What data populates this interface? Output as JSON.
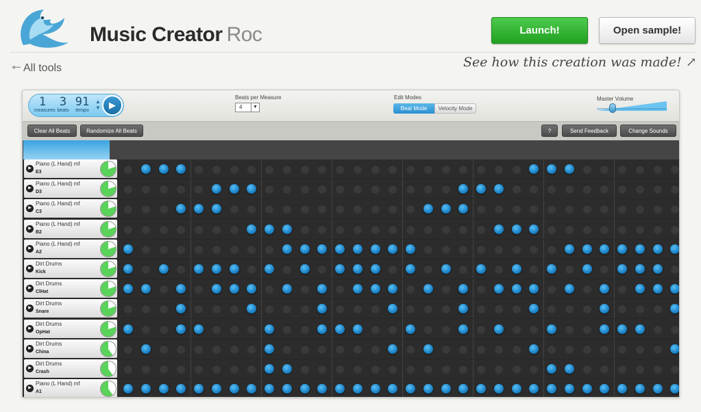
{
  "header": {
    "title": "Music Creator",
    "title_sub": "Roc",
    "launch_label": "Launch!",
    "sample_label": "Open sample!",
    "all_tools_label": "All tools",
    "see_how_label": "See how this creation was made!"
  },
  "counter": {
    "measures": "1",
    "measures_label": "measures",
    "beats": "3",
    "beats_label": "beats",
    "tempo": "91",
    "tempo_label": "tempo"
  },
  "controls": {
    "bpm_label": "Beats per Measure",
    "bpm_value": "4",
    "modes_label": "Edit Modes",
    "beat_mode": "Beat Mode",
    "velocity_mode": "Velocity Mode",
    "volume_label": "Master Volume",
    "volume_level": 0.2
  },
  "toolbar": {
    "clear_all": "Clear All Beats",
    "randomize_all": "Randomize All Beats",
    "help": "?",
    "send_feedback": "Send Feedback",
    "change_sounds": "Change Sounds"
  },
  "colors": {
    "beat_on": "#1b82c7",
    "launch": "#22a022",
    "playhead": "#3aa3e0"
  },
  "rows": [
    {
      "instrument": "Piano (L Hand) mf",
      "note": "E3",
      "beats": [
        1,
        2,
        3,
        23,
        24,
        25
      ]
    },
    {
      "instrument": "Piano (L Hand) mf",
      "note": "D3",
      "beats": [
        5,
        6,
        7,
        19,
        20,
        21
      ]
    },
    {
      "instrument": "Piano (L Hand) mf",
      "note": "C3",
      "beats": [
        3,
        4,
        5,
        17,
        18,
        19
      ]
    },
    {
      "instrument": "Piano (L Hand) mf",
      "note": "B2",
      "beats": [
        7,
        8,
        9,
        21,
        22,
        23
      ]
    },
    {
      "instrument": "Piano (L Hand) mf",
      "note": "A2",
      "beats": [
        0,
        9,
        10,
        11,
        12,
        13,
        14,
        15,
        16,
        25,
        26,
        27,
        28,
        29,
        30,
        31
      ]
    },
    {
      "instrument": "Dirt Drums",
      "note": "Kick",
      "beats": [
        0,
        2,
        4,
        5,
        6,
        8,
        10,
        12,
        13,
        14,
        16,
        18,
        20,
        22,
        24,
        26,
        28,
        29,
        30
      ]
    },
    {
      "instrument": "Dirt Drums",
      "note": "ClHat",
      "beats": [
        0,
        1,
        3,
        5,
        6,
        7,
        9,
        11,
        13,
        14,
        15,
        17,
        19,
        21,
        22,
        23,
        25,
        27,
        29,
        30,
        31
      ]
    },
    {
      "instrument": "Dirt Drums",
      "note": "Snare",
      "beats": [
        3,
        7,
        11,
        15,
        19,
        23,
        27,
        31
      ]
    },
    {
      "instrument": "Dirt Drums",
      "note": "OpHat",
      "beats": [
        0,
        3,
        4,
        8,
        11,
        12,
        13,
        16,
        19,
        21,
        24,
        27,
        28,
        29
      ]
    },
    {
      "instrument": "Dirt Drums",
      "note": "China",
      "beats": [
        1,
        8,
        15,
        17,
        23,
        31
      ]
    },
    {
      "instrument": "Dirt Drums",
      "note": "Crash",
      "beats": [
        8,
        9,
        24,
        25
      ]
    },
    {
      "instrument": "Piano (L Hand) mf",
      "note": "A1",
      "beats": [
        0,
        1,
        2,
        3,
        4,
        5,
        6,
        7,
        8,
        9,
        10,
        11,
        12,
        13,
        14,
        15,
        16,
        17,
        18,
        19,
        20,
        21,
        22,
        23,
        24,
        25,
        26,
        27,
        28,
        29,
        30,
        31
      ]
    }
  ]
}
